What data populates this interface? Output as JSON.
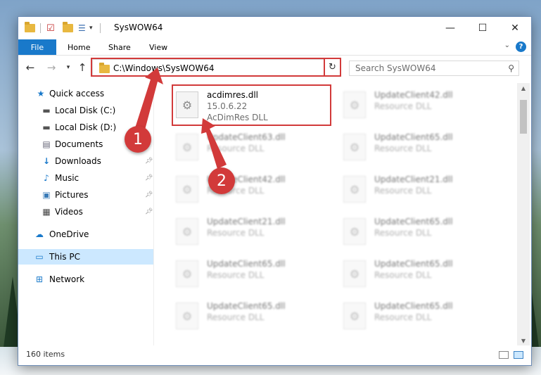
{
  "window": {
    "title": "SysWOW64",
    "controls": [
      "minimize",
      "maximize",
      "close"
    ]
  },
  "ribbon": {
    "tabs": [
      "File",
      "Home",
      "Share",
      "View"
    ]
  },
  "address": {
    "path": "C:\\Windows\\SysWOW64",
    "search_placeholder": "Search SysWOW64"
  },
  "nav": {
    "quick_access": "Quick access",
    "items": [
      {
        "label": "Local Disk (C:)",
        "icon": "drive-icon",
        "pinned": false
      },
      {
        "label": "Local Disk (D:)",
        "icon": "drive-icon",
        "pinned": false
      },
      {
        "label": "Documents",
        "icon": "documents-icon",
        "pinned": false
      },
      {
        "label": "Downloads",
        "icon": "download-icon",
        "pinned": true
      },
      {
        "label": "Music",
        "icon": "music-icon",
        "pinned": true
      },
      {
        "label": "Pictures",
        "icon": "pictures-icon",
        "pinned": true
      },
      {
        "label": "Videos",
        "icon": "videos-icon",
        "pinned": true
      }
    ],
    "onedrive": "OneDrive",
    "this_pc": "This PC",
    "network": "Network"
  },
  "files": {
    "featured": {
      "name": "acdimres.dll",
      "version": "15.0.6.22",
      "description": "AcDimRes DLL"
    },
    "blurred": [
      {
        "name": "UpdateClient42.dll",
        "description": "Resource DLL"
      },
      {
        "name": "UpdateClient63.dll",
        "description": "Resource DLL"
      },
      {
        "name": "UpdateClient65.dll",
        "description": "Resource DLL"
      },
      {
        "name": "UpdateClient42.dll",
        "description": "Resource DLL"
      },
      {
        "name": "UpdateClient21.dll",
        "description": "Resource DLL"
      },
      {
        "name": "UpdateClient21.dll",
        "description": "Resource DLL"
      },
      {
        "name": "UpdateClient65.dll",
        "description": "Resource DLL"
      },
      {
        "name": "UpdateClient65.dll",
        "description": "Resource DLL"
      },
      {
        "name": "UpdateClient65.dll",
        "description": "Resource DLL"
      },
      {
        "name": "UpdateClient65.dll",
        "description": "Resource DLL"
      },
      {
        "name": "UpdateClient65.dll",
        "description": "Resource DLL"
      }
    ]
  },
  "status": {
    "item_count": "160 items"
  },
  "annotations": [
    "1",
    "2"
  ],
  "colors": {
    "accent": "#1979ca",
    "highlight": "#d23a3a",
    "selection": "#cce8ff"
  }
}
